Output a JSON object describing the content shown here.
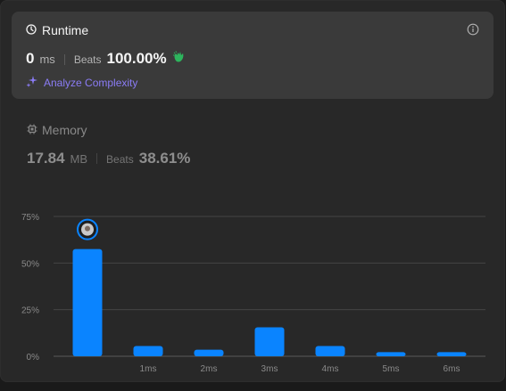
{
  "runtime": {
    "title": "Runtime",
    "value": "0",
    "unit": "ms",
    "beats_label": "Beats",
    "beats_value": "100.00%",
    "analyze_label": "Analyze Complexity"
  },
  "memory": {
    "title": "Memory",
    "value": "17.84",
    "unit": "MB",
    "beats_label": "Beats",
    "beats_value": "38.61%"
  },
  "colors": {
    "bar": "#0a84ff",
    "accent": "#8b7cf6",
    "clap": "#2db55d"
  },
  "chart_data": {
    "type": "bar",
    "y_tick_labels": [
      "0%",
      "25%",
      "50%",
      "75%"
    ],
    "ylim": [
      0,
      75
    ],
    "x_tick_labels": [
      "",
      "1ms",
      "2ms",
      "3ms",
      "4ms",
      "5ms",
      "6ms"
    ],
    "values": [
      57.5,
      5.5,
      3.5,
      15.5,
      5.5,
      2.2,
      2.2
    ],
    "highlight_index": 0,
    "grid": true
  }
}
